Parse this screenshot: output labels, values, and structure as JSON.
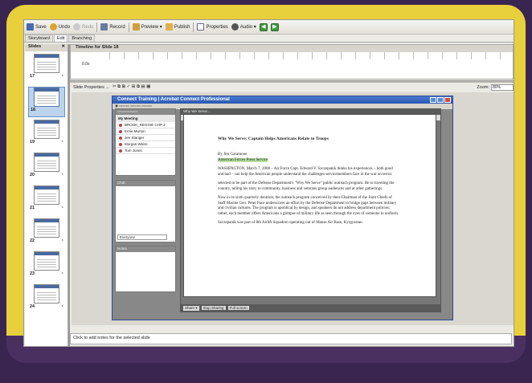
{
  "toolbar": {
    "save": "Save",
    "undo": "Undo",
    "redo": "Redo",
    "record": "Record",
    "preview": "Preview ▾",
    "publish": "Publish",
    "properties": "Properties",
    "audio": "Audio ▾"
  },
  "tabs": [
    "Storyboard",
    "Edit",
    "Branching"
  ],
  "slides_panel": {
    "title": "Slides",
    "items": [
      "17",
      "18",
      "19",
      "20",
      "21",
      "22",
      "23",
      "24"
    ]
  },
  "timeline": {
    "title": "Timeline for Slide 18",
    "time": "0.0s"
  },
  "edit_bar": {
    "slide_properties": "Slide Properties ...",
    "zoom_label": "Zoom:",
    "zoom_value": "80%"
  },
  "app_window": {
    "title": "Connect Training | Acrobat Connect Professional",
    "pod_users": "My Meeting",
    "users": [
      "BROOK_REGGIE CHP 2",
      "Ernie Morton",
      "Jen Stanger",
      "Morgan Weiss",
      "Tom Jones"
    ],
    "pod_chat": "Chat",
    "chat_target": "Everyone",
    "pod_notes": "Notes",
    "share_title": "Why We Serve...",
    "zoom": "100%",
    "share_buttons": [
      "Share ▾",
      "Stop Sharing",
      "Full screen"
    ]
  },
  "document": {
    "headline": "Why We Serve: Captain Helps Americans Relate to Troops",
    "byline": "By Jim Garamone",
    "service": "American Forces Press Service",
    "paragraphs": [
      "WASHINGTON, March 7, 2008 – Air Force Capt. Edward V. Szczepanik thinks his experiences – both good and bad – can help the American people understand the challenges servicemembers face in the war on terror.",
      "selected to be part of the Defense Department's \"Why We Serve\" public outreach program. He is traveling the country, telling his story to community, business and veterans group audiences and at other gatherings.",
      "Now in its sixth quarterly iteration, the outreach program conceived by then-Chairman of the Joint Chiefs of Staff Marine Gen. Peter Pace underscores an effort by the Defense Department to bridge gaps between military and civilian cultures. The program is apolitical by design, and speakers do not address department policies; rather, each member offers Americans a glimpse of military life as seen through the eyes of someone in uniform.",
      "Szczepanik was part of 8th Airlift Squadron operating out of Manas Air Base, Kyrgyzstan."
    ]
  },
  "notes_placeholder": "Click to add notes for the selected slide"
}
